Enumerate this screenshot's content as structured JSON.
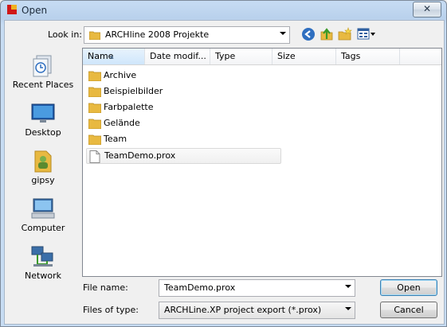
{
  "window": {
    "title": "Open",
    "close_glyph": "✕"
  },
  "look_in": {
    "label": "Look in:",
    "value": "ARCHline 2008 Projekte"
  },
  "toolbar": {
    "back_icon": "back-arrow-icon",
    "up_icon": "up-folder-icon",
    "new_folder_icon": "new-folder-icon",
    "views_icon": "views-menu-icon"
  },
  "places": [
    {
      "label": "Recent Places",
      "icon": "recent-places-icon"
    },
    {
      "label": "Desktop",
      "icon": "desktop-icon"
    },
    {
      "label": "gipsy",
      "icon": "user-folder-icon"
    },
    {
      "label": "Computer",
      "icon": "computer-icon"
    },
    {
      "label": "Network",
      "icon": "network-icon"
    }
  ],
  "columns": [
    "Name",
    "Date modif...",
    "Type",
    "Size",
    "Tags"
  ],
  "items": [
    {
      "name": "Archive",
      "kind": "folder"
    },
    {
      "name": "Beispielbilder",
      "kind": "folder"
    },
    {
      "name": "Farbpalette",
      "kind": "folder"
    },
    {
      "name": "Gelände",
      "kind": "folder"
    },
    {
      "name": "Team",
      "kind": "folder"
    },
    {
      "name": "TeamDemo.prox",
      "kind": "file",
      "selected": true
    }
  ],
  "file_name": {
    "label": "File name:",
    "value": "TeamDemo.prox"
  },
  "file_type": {
    "label": "Files of type:",
    "value": "ARCHLine.XP project export (*.prox)"
  },
  "buttons": {
    "open": "Open",
    "cancel": "Cancel"
  },
  "colors": {
    "folder": "#e8b941",
    "selection_border": "#d9d9d9",
    "accent": "#3c7fb1"
  }
}
